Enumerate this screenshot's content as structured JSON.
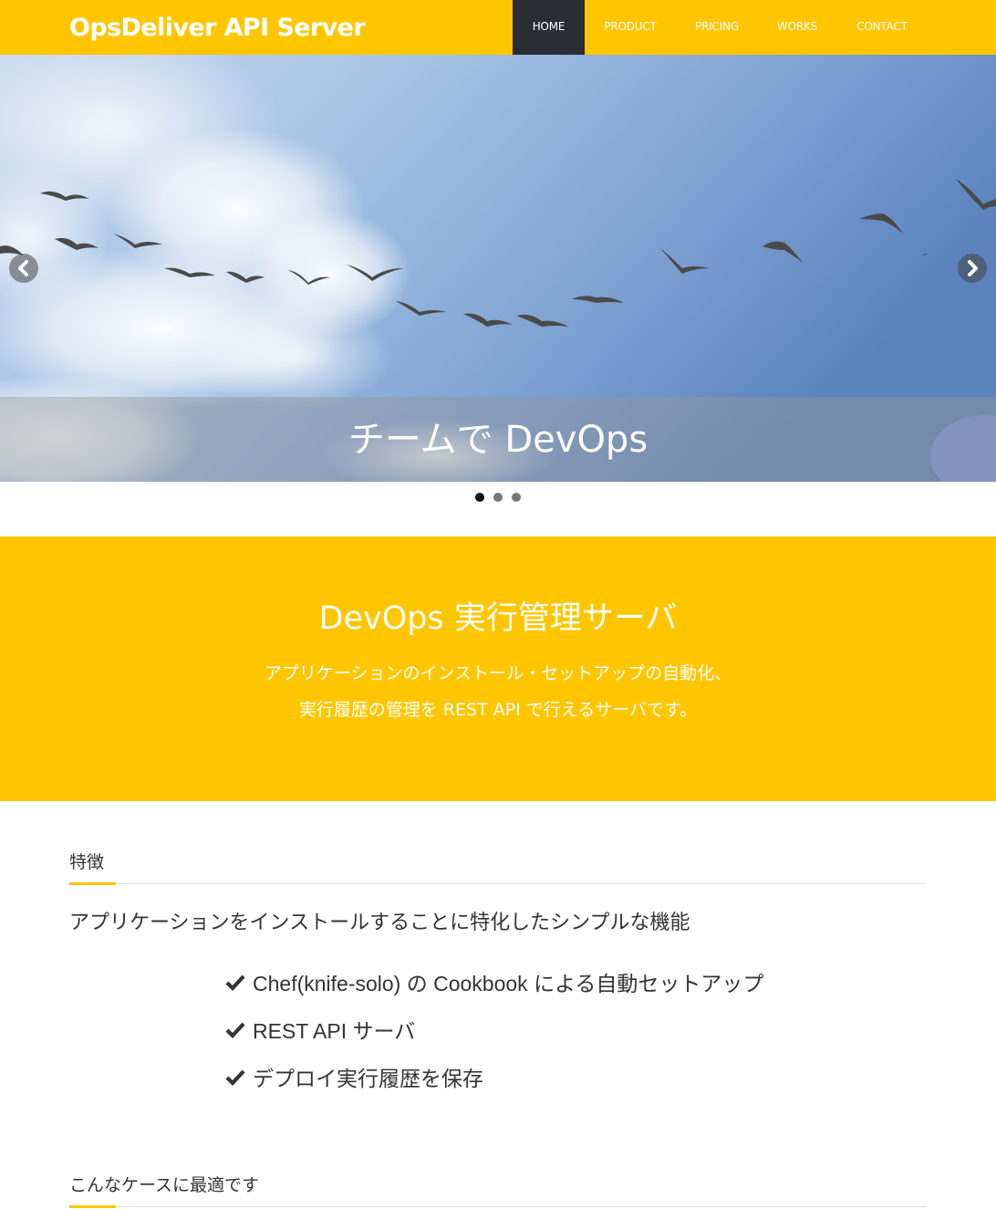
{
  "header": {
    "brand": "OpsDeliver API Server",
    "nav": [
      {
        "label": "HOME",
        "active": true
      },
      {
        "label": "PRODUCT",
        "active": false
      },
      {
        "label": "PRICING",
        "active": false
      },
      {
        "label": "WORKS",
        "active": false
      },
      {
        "label": "CONTACT",
        "active": false
      }
    ]
  },
  "carousel": {
    "caption": "チームで DevOps",
    "prev_icon": "chevron-left-icon",
    "next_icon": "chevron-right-icon",
    "slide_count": 3,
    "active_index": 0
  },
  "intro": {
    "title": "DevOps 実行管理サーバ",
    "line1": "アプリケーションのインストール・セットアップの自動化、",
    "line2": "実行履歴の管理を REST API で行えるサーバです。"
  },
  "features": {
    "heading": "特徴",
    "lead": "アプリケーションをインストールすることに特化したシンプルな機能",
    "items": [
      "Chef(knife-solo) の Cookbook による自動セットアップ",
      "REST API サーバ",
      "デプロイ実行履歴を保存"
    ],
    "item_icon": "check-icon"
  },
  "cases": {
    "heading": "こんなケースに最適です"
  },
  "colors": {
    "accent": "#ffc600",
    "nav_active_bg": "#2a2d33",
    "text": "#333333"
  }
}
